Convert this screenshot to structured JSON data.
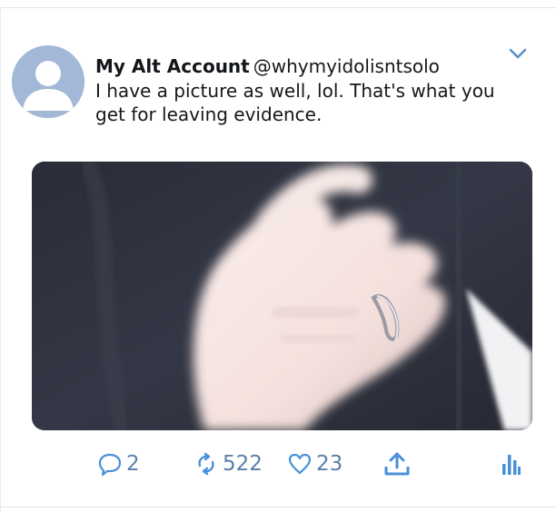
{
  "tweet": {
    "display_name": "My Alt Account",
    "handle": "@whymyidolisntsolo",
    "text": "I have a picture as well, lol. That's what you get for leaving evidence."
  },
  "actions": {
    "reply_count": "2",
    "retweet_count": "522",
    "like_count": "23"
  },
  "icons": {
    "avatar": "default-profile-icon",
    "menu": "chevron-down-icon",
    "reply": "speech-bubble-icon",
    "retweet": "retweet-arrows-icon",
    "like": "heart-icon",
    "share": "share-upload-icon",
    "analytics": "bar-chart-icon"
  },
  "colors": {
    "accent": "#4a90d9",
    "avatar_bg": "#a3b8d6"
  }
}
